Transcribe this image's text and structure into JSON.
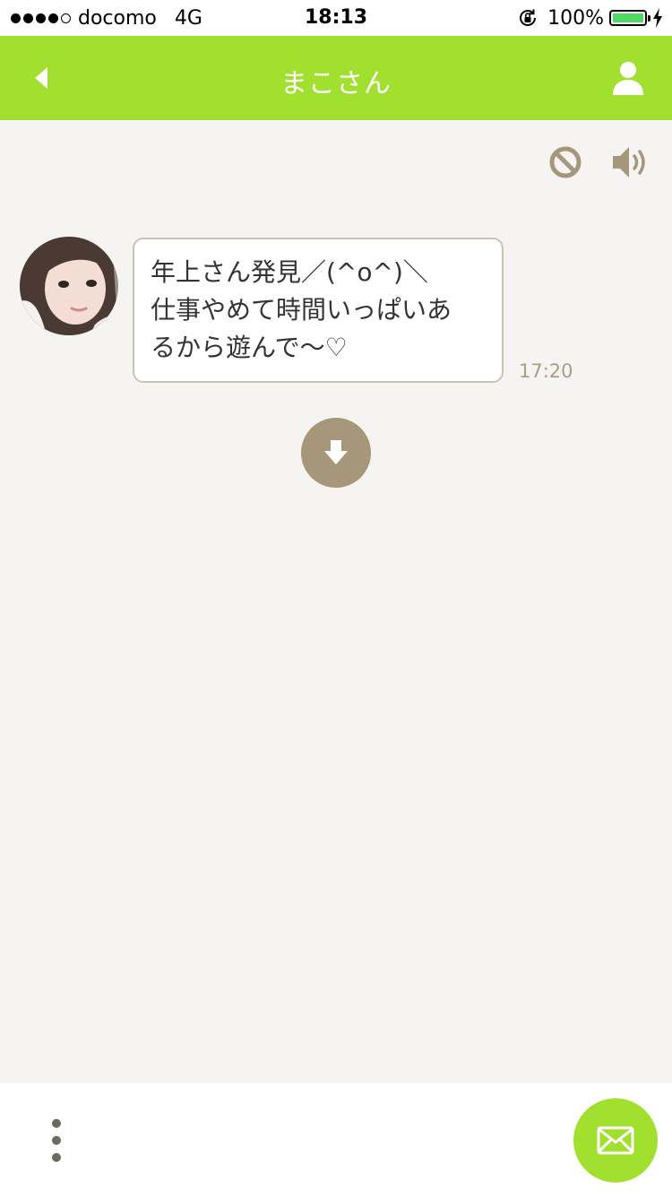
{
  "status_bar": {
    "carrier": "docomo",
    "network": "4G",
    "time": "18:13",
    "battery": "100%",
    "signal_bars_filled": 4,
    "signal_bars_total": 5,
    "battery_level": 1.0
  },
  "nav": {
    "title": "まこさん",
    "back_icon": "back-arrow-icon",
    "profile_icon": "person-icon"
  },
  "toolbar": {
    "block_icon": "block-icon",
    "sound_icon": "speaker-icon"
  },
  "message": {
    "lines": [
      "年上さん発見／(^o^)＼",
      "仕事やめて時間いっぱいあ",
      "るから遊んで〜♡"
    ],
    "time": "17:20"
  },
  "actions": {
    "download_icon": "download-arrow-icon",
    "menu_icon": "more-vertical-icon",
    "compose_icon": "mail-icon"
  },
  "colors": {
    "accent": "#a2e030",
    "background": "#f6f4f2",
    "muted": "#a6977a",
    "bubble_border": "#c9c3b5"
  }
}
